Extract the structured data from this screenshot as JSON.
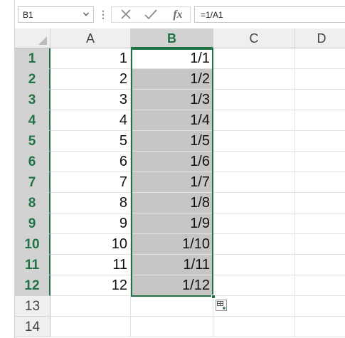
{
  "formula_bar": {
    "name_box": "B1",
    "formula": "=1/A1",
    "cancel_icon": "cancel-x-icon",
    "enter_icon": "enter-check-icon",
    "fx_label": "fx"
  },
  "columns": [
    "A",
    "B",
    "C",
    "D"
  ],
  "selected_column": "B",
  "rows": [
    {
      "num": "1",
      "a": "1",
      "b": "1/1"
    },
    {
      "num": "2",
      "a": "2",
      "b": "1/2"
    },
    {
      "num": "3",
      "a": "3",
      "b": "1/3"
    },
    {
      "num": "4",
      "a": "4",
      "b": "1/4"
    },
    {
      "num": "5",
      "a": "5",
      "b": "1/5"
    },
    {
      "num": "6",
      "a": "6",
      "b": "1/6"
    },
    {
      "num": "7",
      "a": "7",
      "b": "1/7"
    },
    {
      "num": "8",
      "a": "8",
      "b": "1/8"
    },
    {
      "num": "9",
      "a": "9",
      "b": "1/9"
    },
    {
      "num": "10",
      "a": "10",
      "b": "1/10"
    },
    {
      "num": "11",
      "a": "11",
      "b": "1/11"
    },
    {
      "num": "12",
      "a": "12",
      "b": "1/12"
    },
    {
      "num": "13",
      "a": "",
      "b": ""
    },
    {
      "num": "14",
      "a": "",
      "b": ""
    }
  ],
  "selected_rows": 12,
  "active_cell": "B1",
  "colors": {
    "accent": "#217346",
    "selection_fill": "#c6c6c6",
    "header_bg": "#efefef",
    "selected_header_bg": "#d2d2d2"
  }
}
